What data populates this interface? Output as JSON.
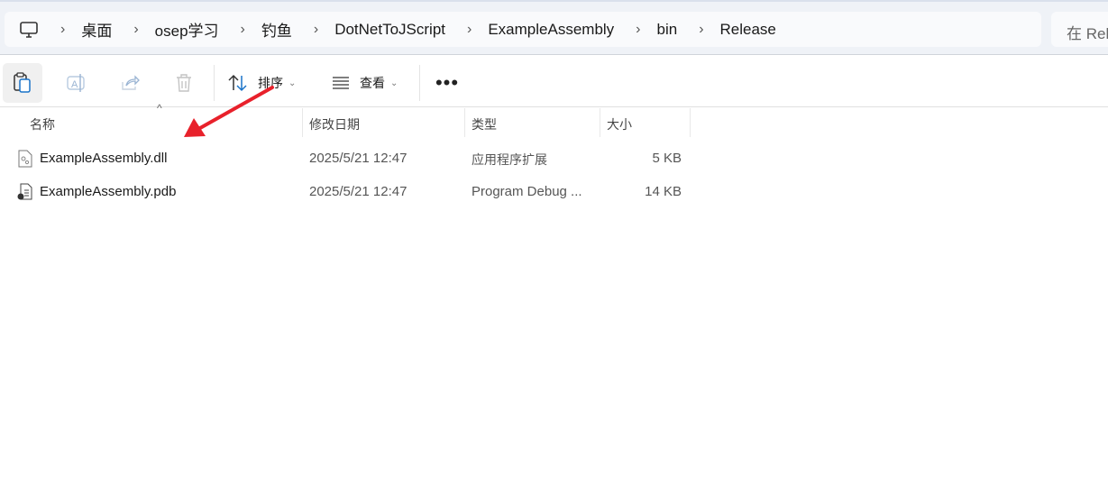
{
  "breadcrumb": [
    "桌面",
    "osep学习",
    "钓鱼",
    "DotNetToJScript",
    "ExampleAssembly",
    "bin",
    "Release"
  ],
  "search": {
    "placeholder": "在 Rel"
  },
  "toolbar": {
    "sort_label": "排序",
    "view_label": "查看"
  },
  "columns": [
    "名称",
    "修改日期",
    "类型",
    "大小"
  ],
  "files": [
    {
      "name": "ExampleAssembly.dll",
      "modified": "2025/5/21 12:47",
      "type": "应用程序扩展",
      "size": "5 KB",
      "icon": "dll-file-icon"
    },
    {
      "name": "ExampleAssembly.pdb",
      "modified": "2025/5/21 12:47",
      "type": "Program Debug ...",
      "size": "14 KB",
      "icon": "pdb-file-icon"
    }
  ],
  "annotation_color": "#e8212b"
}
